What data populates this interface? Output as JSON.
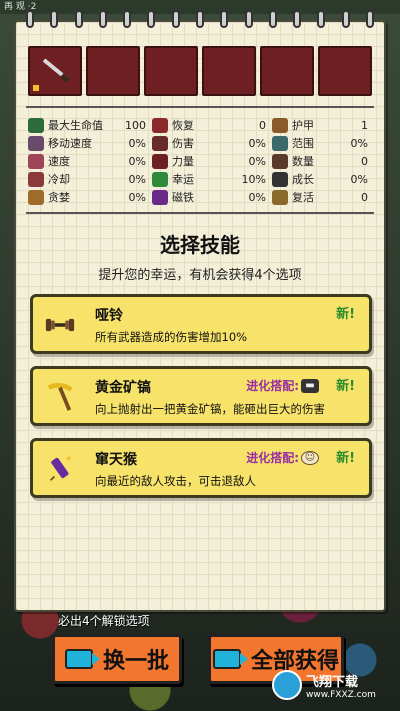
{
  "hud": {
    "corner_text": "再 观 ·2"
  },
  "stats": [
    {
      "icon": "heart-icon",
      "color": "#2e6b3a",
      "label": "最大生命值",
      "value": "100"
    },
    {
      "icon": "potion-icon",
      "color": "#8a2a2a",
      "label": "恢复",
      "value": "0"
    },
    {
      "icon": "armor-icon",
      "color": "#8a5a2a",
      "label": "护甲",
      "value": "1"
    },
    {
      "icon": "boot-icon",
      "color": "#6a4a6a",
      "label": "移动速度",
      "value": "0%"
    },
    {
      "icon": "sword-icon",
      "color": "#6a2a2a",
      "label": "伤害",
      "value": "0%"
    },
    {
      "icon": "range-icon",
      "color": "#3a6a6a",
      "label": "范围",
      "value": "0%"
    },
    {
      "icon": "speed-icon",
      "color": "#a0445a",
      "label": "速度",
      "value": "0%"
    },
    {
      "icon": "power-icon",
      "color": "#6e1f22",
      "label": "力量",
      "value": "0%"
    },
    {
      "icon": "amount-icon",
      "color": "#5a3a2a",
      "label": "数量",
      "value": "0"
    },
    {
      "icon": "cooldown-icon",
      "color": "#8a3a3a",
      "label": "冷却",
      "value": "0%"
    },
    {
      "icon": "clover-icon",
      "color": "#2e8a3a",
      "label": "幸运",
      "value": "10%"
    },
    {
      "icon": "glasses-icon",
      "color": "#333333",
      "label": "成长",
      "value": "0%"
    },
    {
      "icon": "greed-icon",
      "color": "#a06a2a",
      "label": "贪婪",
      "value": "0%"
    },
    {
      "icon": "magnet-icon",
      "color": "#6a2a8a",
      "label": "磁铁",
      "value": "0%"
    },
    {
      "icon": "revive-icon",
      "color": "#8a6a2a",
      "label": "复活",
      "value": "0"
    }
  ],
  "title": "选择技能",
  "subtitle": "提升您的幸运，有机会获得4个选项",
  "cards": [
    {
      "name": "哑铃",
      "desc": "所有武器造成的伤害增加10%",
      "new": "新!",
      "evo": ""
    },
    {
      "name": "黄金矿镐",
      "desc": "向上抛射出一把黄金矿镐，能砸出巨大的伤害",
      "new": "新!",
      "evo": "进化搭配:"
    },
    {
      "name": "窜天猴",
      "desc": "向最近的敌人攻击，可击退敌人",
      "new": "新!",
      "evo": "进化搭配:"
    }
  ],
  "hint": "必出4个解锁选项",
  "buttons": {
    "reroll": "换一批",
    "get_all": "全部获得"
  },
  "watermark": {
    "name": "飞翔下载",
    "url": "www.FXXZ.com"
  }
}
